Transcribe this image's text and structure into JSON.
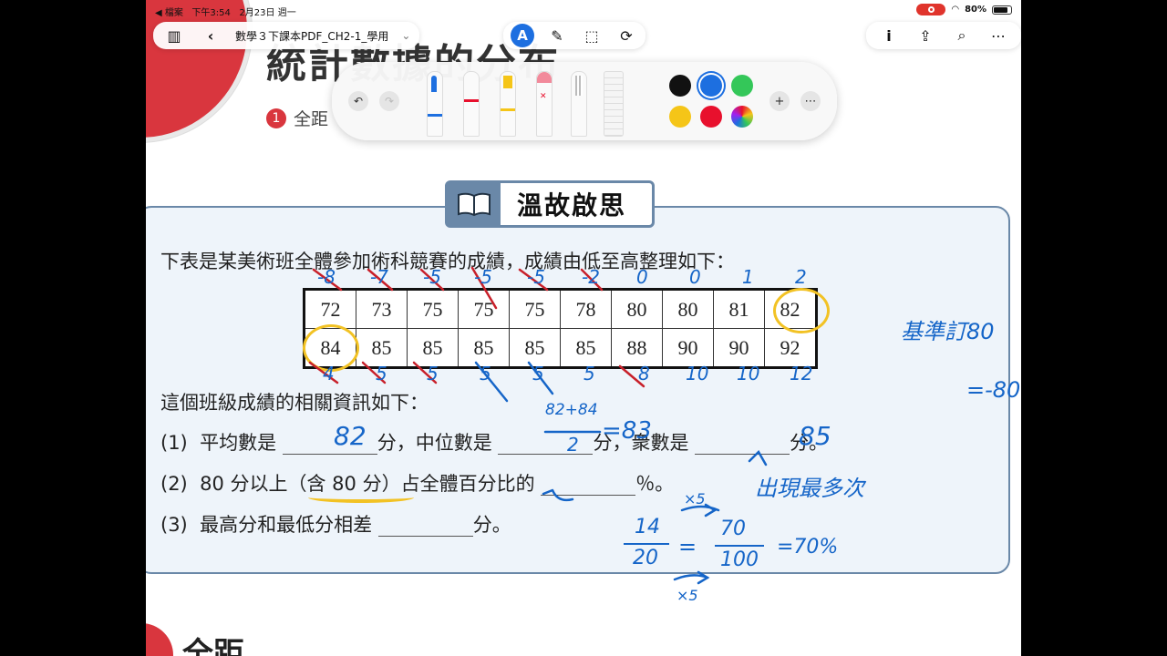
{
  "status_bar": {
    "back_app": "◀ 檔案",
    "time": "下午3:54",
    "date": "2月23日 週一",
    "battery": "80%"
  },
  "toolbar": {
    "doc_title": "數學３下課本PDF_CH2-1_學用",
    "title_chevron": "⌄"
  },
  "page": {
    "bg_title": "統計數據的分布",
    "bg_sub_number": "1",
    "bg_sub_text": "全距",
    "bottom_title": "全距"
  },
  "colors": {
    "swatches": [
      "#111111",
      "#1d6fe0",
      "#34c759",
      "#f5c518",
      "#e8102d"
    ],
    "accent": "#1d6fe0",
    "ink": "#1565c8",
    "highlight": "#f2c224"
  },
  "review": {
    "badge": "溫故啟思",
    "intro": "下表是某美術班全體參加術科競賽的成績，成績由低至高整理如下：",
    "row1": [
      "72",
      "73",
      "75",
      "75",
      "75",
      "78",
      "80",
      "80",
      "81",
      "82"
    ],
    "row2": [
      "84",
      "85",
      "85",
      "85",
      "85",
      "85",
      "88",
      "90",
      "90",
      "92"
    ],
    "info": "這個班級成績的相關資訊如下：",
    "q1_num": "(1)",
    "q1_a": "平均數是",
    "q1_b": "分，中位數是",
    "q1_c": "分，衆數是",
    "q1_d": "分。",
    "q2_num": "(2)",
    "q2_a": "80 分以上（含 80 分）占全體百分比的",
    "q2_b": "％。",
    "q3_num": "(3)",
    "q3_a": "最高分和最低分相差",
    "q3_b": "分。"
  },
  "handwriting": {
    "top_marks": [
      "-8",
      "-7",
      "-5",
      "-5",
      "-5",
      "-2",
      "0",
      "0",
      "1",
      "2"
    ],
    "bottom_marks": [
      "4",
      "5",
      "5",
      "5",
      "5",
      "5",
      "8",
      "10",
      "10",
      "12"
    ],
    "mean": "82",
    "median_fraction_top": "82+84",
    "median_fraction_bottom": "2",
    "median": "=83",
    "mode": "85",
    "mode_note": "出現最多次",
    "base_note": "基準訂80",
    "base_minus": "=-80",
    "pct_frac_top": "14",
    "pct_frac_bottom": "20",
    "pct_eq": "=",
    "pct_frac2_top": "70",
    "pct_frac2_bottom": "100",
    "pct_result": "=70%",
    "times5_top": "×5",
    "times5_bottom": "×5"
  }
}
